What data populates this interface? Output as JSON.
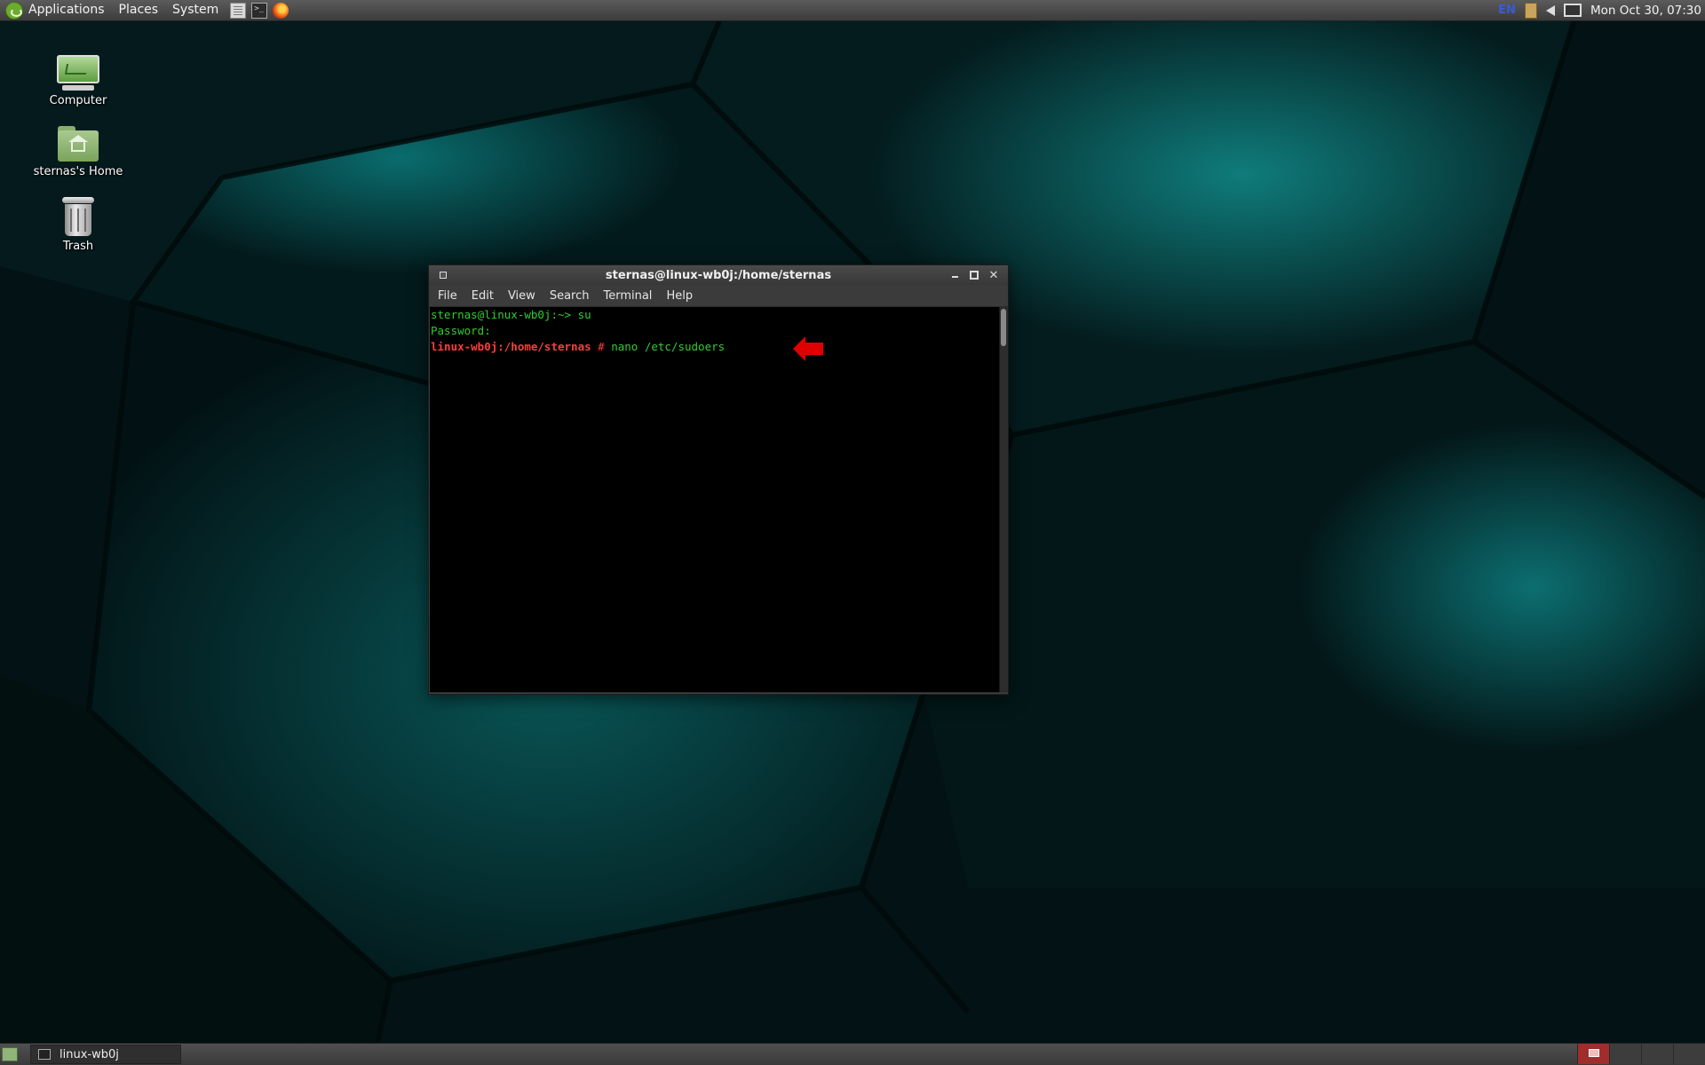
{
  "top_panel": {
    "menus": [
      "Applications",
      "Places",
      "System"
    ],
    "launchers": [
      "files-icon",
      "terminal-icon",
      "firefox-icon"
    ],
    "tray": {
      "language": "EN",
      "clock": "Mon Oct 30, 07:30"
    }
  },
  "desktop": {
    "icons": [
      {
        "label": "Computer",
        "icon": "computer-icon"
      },
      {
        "label": "sternas's Home",
        "icon": "home-folder-icon"
      },
      {
        "label": "Trash",
        "icon": "trash-icon"
      }
    ]
  },
  "terminal": {
    "title": "sternas@linux-wb0j:/home/sternas",
    "menu": [
      "File",
      "Edit",
      "View",
      "Search",
      "Terminal",
      "Help"
    ],
    "lines": {
      "line1_prompt": "sternas@linux-wb0j:~>",
      "line1_command": " su",
      "line2": "Password:",
      "line3_prompt": "linux-wb0j:/home/sternas",
      "line3_hash": " #",
      "line3_command": " nano /etc/sudoers"
    },
    "colors": {
      "user_prompt": "#32cd32",
      "root_prompt": "#ff3c3c"
    }
  },
  "annotation": {
    "arrow_color": "#e00000",
    "arrow_direction": "left"
  },
  "bottom_panel": {
    "task": "linux-wb0j"
  },
  "colors": {
    "wallpaper_dark": "#031618",
    "wallpaper_teal": "#0b6f70"
  }
}
